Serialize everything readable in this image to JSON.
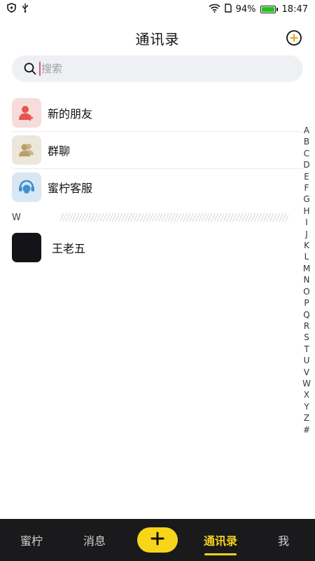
{
  "status_bar": {
    "battery_percent": "94%",
    "time": "18:47",
    "battery_color": "#22c21f",
    "icons": [
      "shield-icon",
      "usb-icon",
      "wifi-icon",
      "sim-icon",
      "battery-icon"
    ]
  },
  "header": {
    "title": "通讯录",
    "add_icon": "plus-circle-icon"
  },
  "search": {
    "placeholder": "搜索",
    "value": "",
    "icon": "search-icon"
  },
  "list": [
    {
      "label": "新的朋友",
      "icon": "add-friend-icon",
      "color": "#e8554a"
    },
    {
      "label": "群聊",
      "icon": "group-chat-icon",
      "color": "#b99f6c"
    },
    {
      "label": "蜜柠客服",
      "icon": "customer-service-icon",
      "color": "#3f8fd0"
    }
  ],
  "section": {
    "letter": "W"
  },
  "contacts": [
    {
      "name": "王老五"
    }
  ],
  "index_letters": [
    "A",
    "B",
    "C",
    "D",
    "E",
    "F",
    "G",
    "H",
    "I",
    "J",
    "K",
    "L",
    "M",
    "N",
    "O",
    "P",
    "Q",
    "R",
    "S",
    "T",
    "U",
    "V",
    "W",
    "X",
    "Y",
    "Z",
    "#"
  ],
  "tabbar": {
    "tabs": [
      {
        "label": "蜜柠"
      },
      {
        "label": "消息"
      },
      {
        "label": "通讯录",
        "active": true
      },
      {
        "label": "我"
      }
    ],
    "center_icon": "plus-icon",
    "accent": "#f5d31a",
    "background": "#1a1a1c"
  }
}
